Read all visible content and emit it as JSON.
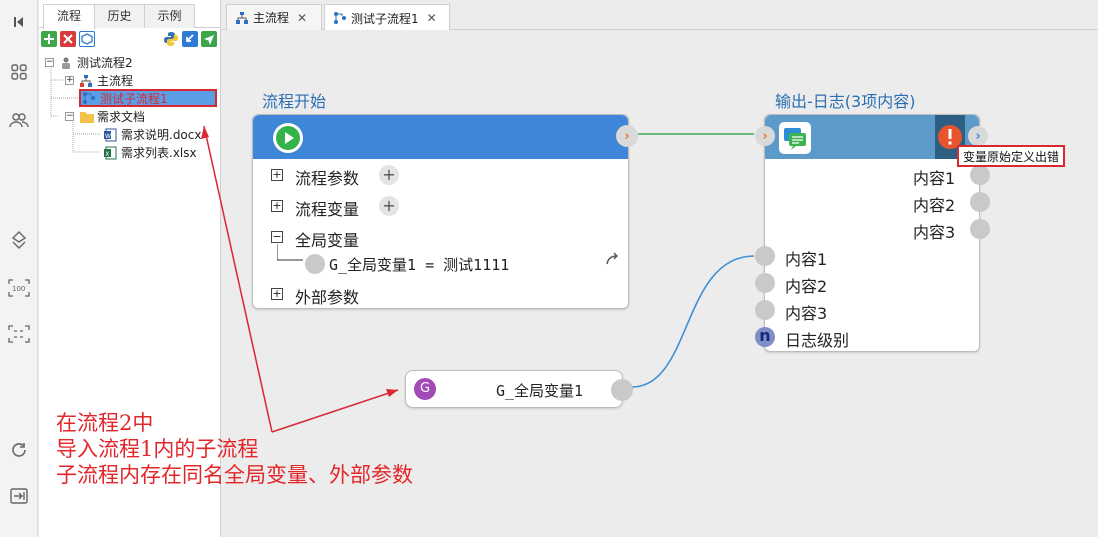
{
  "tree": {
    "tabs": [
      "流程",
      "历史",
      "示例"
    ],
    "root": "测试流程2",
    "items": [
      "主流程",
      "测试子流程1",
      "需求文档",
      "需求说明.docx",
      "需求列表.xlsx"
    ]
  },
  "editor": {
    "tabs": [
      "主流程",
      "测试子流程1"
    ]
  },
  "canvas": {
    "start_node": {
      "title": "流程开始",
      "rows": [
        "流程参数",
        "流程变量",
        "全局变量",
        "外部参数"
      ],
      "global_var": "G_全局变量1 = 测试1111"
    },
    "log_node": {
      "title": "输出-日志(3项内容)",
      "outputs": [
        "内容1",
        "内容2",
        "内容3"
      ],
      "inputs": [
        "内容1",
        "内容2",
        "内容3",
        "日志级别"
      ],
      "level_badge": "n"
    },
    "var_node": {
      "badge": "G",
      "label": "G_全局变量1"
    },
    "tooltip": "变量原始定义出错"
  },
  "annotation": {
    "lines": [
      "在流程2中",
      "导入流程1内的子流程",
      "子流程内存在同名全局变量、外部参数"
    ]
  },
  "colors": {
    "accent": "#3f86d9",
    "log_head": "#5b9ac9",
    "annotation": "#e3262a",
    "run_button": "#34b34a",
    "error": "#e8542b"
  }
}
